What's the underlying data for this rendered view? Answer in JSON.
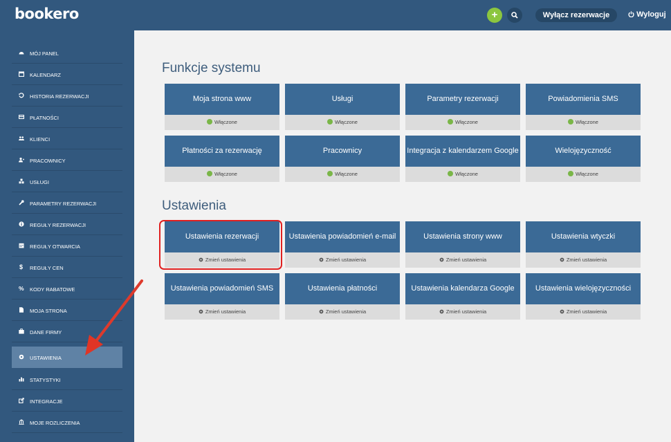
{
  "header": {
    "logo": "bookero",
    "plus_label": "+",
    "toggle_label": "Wyłącz rezerwacje",
    "logout_label": "Wyloguj"
  },
  "sidebar": {
    "items": [
      {
        "label": "Mój panel",
        "icon": "dashboard-icon"
      },
      {
        "label": "Kalendarz",
        "icon": "calendar-icon"
      },
      {
        "label": "Historia rezerwacji",
        "icon": "history-icon"
      },
      {
        "label": "Płatności",
        "icon": "credit-card-icon"
      },
      {
        "label": "Klienci",
        "icon": "users-icon"
      },
      {
        "label": "Pracownicy",
        "icon": "user-plus-icon"
      },
      {
        "label": "Usługi",
        "icon": "cubes-icon"
      },
      {
        "label": "Parametry rezerwacji",
        "icon": "wrench-icon"
      },
      {
        "label": "Reguły rezerwacji",
        "icon": "info-icon"
      },
      {
        "label": "Reguły otwarcia",
        "icon": "calendar-grid-icon"
      },
      {
        "label": "Reguły cen",
        "icon": "dollar-icon"
      },
      {
        "label": "Kody rabatowe",
        "icon": "percent-icon"
      },
      {
        "label": "Moja strona",
        "icon": "file-icon"
      },
      {
        "label": "Dane firmy",
        "icon": "briefcase-icon"
      },
      {
        "label": "Ustawienia",
        "icon": "gear-icon",
        "active": true
      },
      {
        "label": "Statystyki",
        "icon": "bar-chart-icon"
      },
      {
        "label": "Integracje",
        "icon": "external-link-icon"
      },
      {
        "label": "Moje rozliczenia",
        "icon": "bank-icon"
      }
    ]
  },
  "sections": {
    "functions": {
      "title": "Funkcje systemu",
      "status_label": "Włączone",
      "tiles": [
        "Moja strona www",
        "Usługi",
        "Parametry rezerwacji",
        "Powiadomienia SMS",
        "Płatności za rezerwację",
        "Pracownicy",
        "Integracja z kalendarzem Google",
        "Wielojęzyczność"
      ]
    },
    "settings": {
      "title": "Ustawienia",
      "action_label": "Zmień ustawienia",
      "tiles": [
        "Ustawienia rezerwacji",
        "Ustawienia powiadomień e-mail",
        "Ustawienia strony www",
        "Ustawienia wtyczki",
        "Ustawienia powiadomień SMS",
        "Ustawienia płatności",
        "Ustawienia kalendarza Google",
        "Ustawienia wielojęzyczności"
      ]
    }
  },
  "colors": {
    "header_bg": "#32587e",
    "tile_bg": "#3b6a96",
    "status_green": "#7ab648",
    "annotation_red": "#e02020"
  }
}
